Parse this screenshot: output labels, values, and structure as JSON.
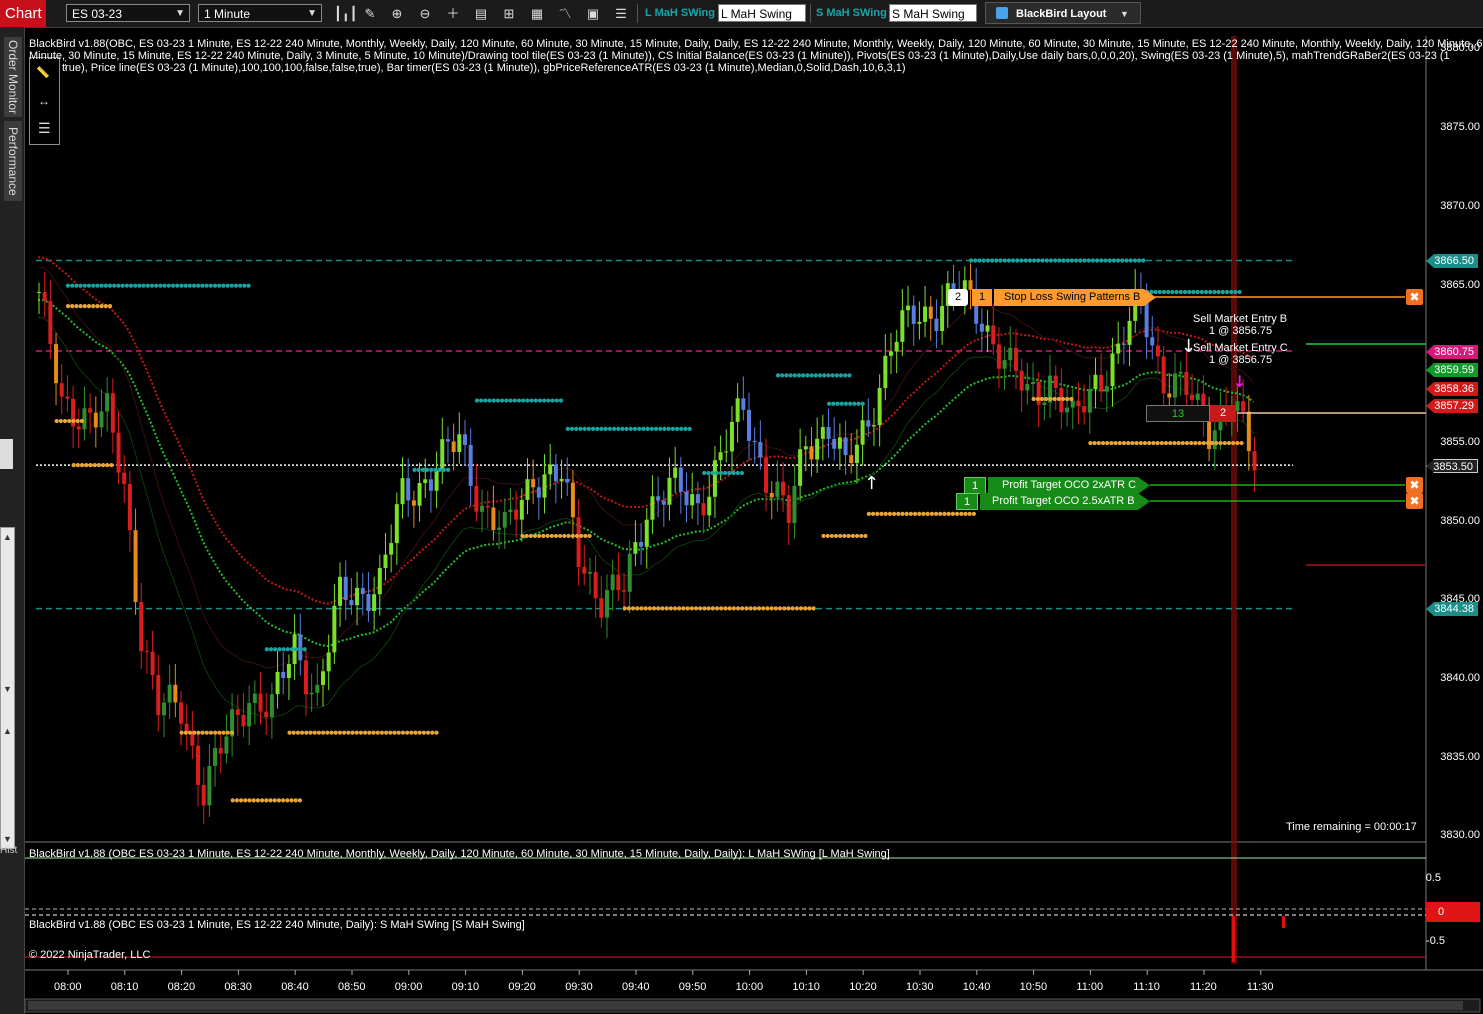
{
  "toolbar": {
    "chart_tab": "Chart",
    "instrument": "ES 03-23",
    "interval": "1 Minute",
    "l_label": "L MaH SWing",
    "l_box": "L MaH Swing",
    "s_label": "S MaH SWing",
    "s_box": "S MaH Swing",
    "layout": "BlackBird Layout",
    "icons": [
      "bar-type-icon",
      "draw-pencil-icon",
      "zoom-in-icon",
      "zoom-out-icon",
      "crosshair-icon",
      "properties-icon",
      "data-box-icon",
      "strategies-icon",
      "indicators-icon",
      "chart-trader-icon",
      "more-icon"
    ]
  },
  "side_tabs": [
    "Order Monitor",
    "Performance"
  ],
  "left_labels": [
    "Hist"
  ],
  "indicator_text": {
    "line1": "BlackBird v1.88(OBC, ES 03-23 1 Minute, ES 12-22 240 Minute, Monthly, Weekly, Daily, 120 Minute, 60 Minute, 30 Minute, 15 Minute, Daily, Daily, ES 12-22 240 Minute, Monthly, Weekly, Daily, 120 Minute, 60 Minute, 30 Minute, 15 Minute, ES 12-22 240 Minute, Monthly, Weekly, Daily, 120 Minute, 60",
    "line2": "Minute, 30 Minute, 15 Minute, ES 12-22 240 Minute, Daily, 3 Minute, 5 Minute, 10 Minute)/Drawing tool tile(ES 03-23 (1 Minute)), CS Initial Balance(ES 03-23 (1 Minute)), Pivots(ES 03-23 (1 Minute),Daily,Use daily bars,0,0,0,20), Swing(ES 03-23 (1 Minute),5), mahTrendGRaBer2(ES 03-23 (1",
    "line3": "true), Price line(ES 03-23 (1 Minute),100,100,100,false,false,true), Bar timer(ES 03-23 (1 Minute)), gbPriceReferenceATR(ES 03-23 (1 Minute),Median,0,Solid,Dash,10,6,3,1)"
  },
  "price_axis": [
    "3880.00",
    "3875.00",
    "3870.00",
    "3865.00",
    "3855.00",
    "3850.00",
    "3845.00",
    "3840.00",
    "3835.00",
    "3830.00"
  ],
  "price_tags": [
    {
      "label": "3866.50",
      "color": "#1a8f8a"
    },
    {
      "label": "3860.75",
      "color": "#d6187a"
    },
    {
      "label": "3859.59",
      "color": "#119a2a"
    },
    {
      "label": "3858.36",
      "color": "#d11a1a"
    },
    {
      "label": "3857.29",
      "color": "#d11a1a"
    },
    {
      "label": "3853.50",
      "color": "#222222"
    },
    {
      "label": "3844.38",
      "color": "#1a8f8a"
    }
  ],
  "orders": {
    "stop": {
      "qty": "2",
      "count": "1",
      "label": "Stop Loss Swing Patterns B"
    },
    "pt_c": {
      "count": "1",
      "label": "Profit Target OCO  2xATR C"
    },
    "pt_b": {
      "count": "1",
      "label": "Profit Target OCO  2.5xATR B"
    },
    "entry_b": {
      "line1": "Sell Market Entry B",
      "line2": "1 @ 3856.75"
    },
    "entry_c": {
      "line1": "Sell Market Entry C",
      "line2": "1 @ 3856.75"
    },
    "position": {
      "ticks": "13",
      "qty": "2"
    }
  },
  "time_remaining": "Time remaining = 00:00:17",
  "panel1": {
    "label": "BlackBird v1.88 (OBC ES 03-23 1 Minute, ES 12-22 240 Minute, Monthly, Weekly, Daily, 120 Minute, 60 Minute, 30 Minute, 15 Minute, Daily, Daily): L MaH SWing  [L MaH Swing]",
    "axis": [
      "0.5",
      "0",
      "-0.5"
    ]
  },
  "panel2": {
    "label": "BlackBird v1.88 (OBC ES 03-23 1 Minute, ES 12-22 240 Minute, Daily): S MaH SWing  [S MaH Swing]",
    "tag": "0"
  },
  "copyright": "© 2022 NinjaTrader, LLC",
  "time_axis": [
    "08:00",
    "08:10",
    "08:20",
    "08:30",
    "08:40",
    "08:50",
    "09:00",
    "09:10",
    "09:20",
    "09:30",
    "09:40",
    "09:50",
    "10:00",
    "10:10",
    "10:20",
    "10:30",
    "10:40",
    "10:50",
    "11:00",
    "11:10",
    "11:20",
    "11:30"
  ],
  "chart_data": {
    "type": "candlestick",
    "instrument": "ES 03-23",
    "interval": "1 Minute",
    "ylim": [
      3829.5,
      3880.5
    ],
    "x": [
      "08:00",
      "11:34"
    ],
    "close_trace": [
      [
        "08:00",
        3864.5
      ],
      [
        "08:04",
        3857
      ],
      [
        "08:08",
        3857
      ],
      [
        "08:12",
        3856.5
      ],
      [
        "08:15",
        3852
      ],
      [
        "08:18",
        3843
      ],
      [
        "08:21",
        3838
      ],
      [
        "08:25",
        3838
      ],
      [
        "08:29",
        3833
      ],
      [
        "08:33",
        3836
      ],
      [
        "08:37",
        3839
      ],
      [
        "08:41",
        3838
      ],
      [
        "08:45",
        3842
      ],
      [
        "08:49",
        3839
      ],
      [
        "08:53",
        3845
      ],
      [
        "09:00",
        3846
      ],
      [
        "09:04",
        3851.5
      ],
      [
        "09:09",
        3853
      ],
      [
        "09:14",
        3855
      ],
      [
        "09:18",
        3851
      ],
      [
        "09:22",
        3849
      ],
      [
        "09:27",
        3853
      ],
      [
        "09:32",
        3852.5
      ],
      [
        "09:35",
        3848
      ],
      [
        "09:39",
        3845
      ],
      [
        "09:43",
        3845.5
      ],
      [
        "09:47",
        3851
      ],
      [
        "09:51",
        3852
      ],
      [
        "09:56",
        3851
      ],
      [
        "10:00",
        3854
      ],
      [
        "10:04",
        3857
      ],
      [
        "10:08",
        3853
      ],
      [
        "10:12",
        3850
      ],
      [
        "10:15",
        3855
      ],
      [
        "10:19",
        3856
      ],
      [
        "10:22",
        3853
      ],
      [
        "10:26",
        3856.5
      ],
      [
        "10:30",
        3861
      ],
      [
        "10:34",
        3863
      ],
      [
        "10:38",
        3863.5
      ],
      [
        "10:42",
        3864.5
      ],
      [
        "10:46",
        3863
      ],
      [
        "10:50",
        3860
      ],
      [
        "10:54",
        3858
      ],
      [
        "10:58",
        3859
      ],
      [
        "11:02",
        3856
      ],
      [
        "11:06",
        3859
      ],
      [
        "11:10",
        3860.5
      ],
      [
        "11:14",
        3864
      ],
      [
        "11:18",
        3859
      ],
      [
        "11:22",
        3858
      ],
      [
        "11:26",
        3856
      ],
      [
        "11:30",
        3857.5
      ],
      [
        "11:34",
        3853.5
      ]
    ],
    "levels": [
      {
        "label": "3866.50",
        "value": 3866.5,
        "style": "dashed",
        "color": "#1a8f8a"
      },
      {
        "label": "3860.75",
        "value": 3860.75,
        "style": "dashed",
        "color": "#d6187a"
      },
      {
        "label": "3844.38",
        "value": 3844.38,
        "style": "dashed",
        "color": "#1a8f8a"
      },
      {
        "label": "3853.50",
        "value": 3853.5,
        "style": "dotted",
        "color": "#ffffff"
      }
    ]
  }
}
